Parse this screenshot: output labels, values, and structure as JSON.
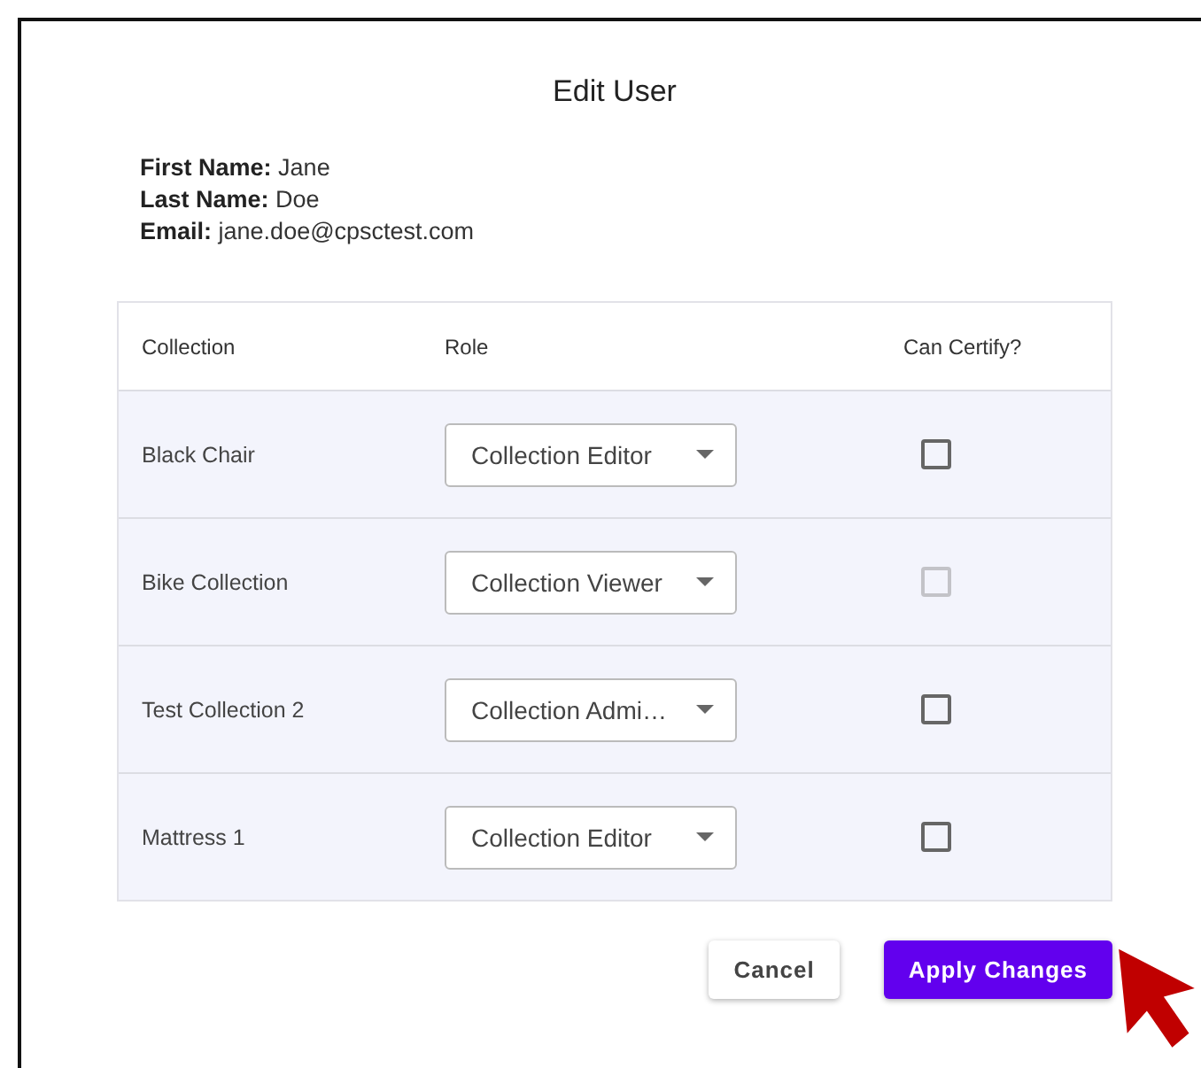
{
  "dialog": {
    "title": "Edit User",
    "info": [
      {
        "label": "First Name:",
        "value": "Jane"
      },
      {
        "label": "Last Name:",
        "value": "Doe"
      },
      {
        "label": "Email:",
        "value": "jane.doe@cpsctest.com"
      }
    ]
  },
  "table": {
    "columns": [
      "Collection",
      "Role",
      "Can Certify?"
    ],
    "rows": [
      {
        "collection": "Black Chair",
        "role": "Collection Editor",
        "can_certify": {
          "checked": false,
          "disabled": false
        }
      },
      {
        "collection": "Bike Collection",
        "role": "Collection Viewer",
        "can_certify": {
          "checked": false,
          "disabled": true
        }
      },
      {
        "collection": "Test Collection 2",
        "role": "Collection Admi…",
        "can_certify": {
          "checked": false,
          "disabled": false
        }
      },
      {
        "collection": "Mattress 1",
        "role": "Collection Editor",
        "can_certify": {
          "checked": false,
          "disabled": false
        }
      }
    ]
  },
  "buttons": [
    {
      "label": "Cancel",
      "kind": "secondary"
    },
    {
      "label": "Apply Changes",
      "kind": "primary"
    }
  ]
}
